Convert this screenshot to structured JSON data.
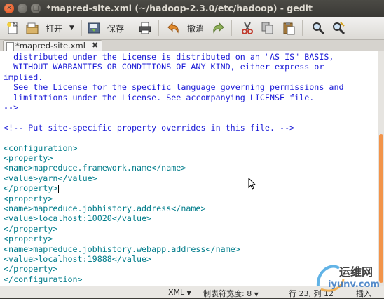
{
  "window": {
    "title": "*mapred-site.xml (~/hadoop-2.3.0/etc/hadoop) - gedit"
  },
  "toolbar": {
    "new_icon": "new-document-icon",
    "open_label": "打开",
    "save_label": "保存",
    "undo_label": "撤消",
    "icons": [
      "new-document-icon",
      "open-icon",
      "dropdown-arrow-icon",
      "save-icon",
      "print-icon",
      "undo-icon",
      "redo-icon",
      "cut-icon",
      "copy-icon",
      "paste-icon",
      "find-icon",
      "replace-icon"
    ]
  },
  "tab": {
    "label": "*mapred-site.xml"
  },
  "editor": {
    "lines": [
      "  distributed under the License is distributed on an \"AS IS\" BASIS,",
      "  WITHOUT WARRANTIES OR CONDITIONS OF ANY KIND, either express or",
      "implied.",
      "  See the License for the specific language governing permissions and",
      "  limitations under the License. See accompanying LICENSE file.",
      "-->",
      "",
      "<!-- Put site-specific property overrides in this file. -->",
      "",
      "<configuration>",
      "<property>",
      "<name>mapreduce.framework.name</name>",
      "<value>yarn</value>",
      "</property>",
      "<property>",
      "<name>mapreduce.jobhistory.address</name>",
      "<value>localhost:10020</value>",
      "</property>",
      "<property>",
      "<name>mapreduce.jobhistory.webapp.address</name>",
      "<value>localhost:19888</value>",
      "</property>",
      "</configuration>"
    ]
  },
  "statusbar": {
    "language": "XML",
    "tab_width": "制表符宽度: 8",
    "position": "行 23, 列 12",
    "insert_mode": "插入"
  },
  "watermark": {
    "text_cn": "运维网",
    "text_en": "iyunv.com"
  },
  "colors": {
    "comment": "#1a1ad6",
    "tag": "#007c8a",
    "scroll_thumb": "#f2944a",
    "close_button": "#df4a16"
  }
}
